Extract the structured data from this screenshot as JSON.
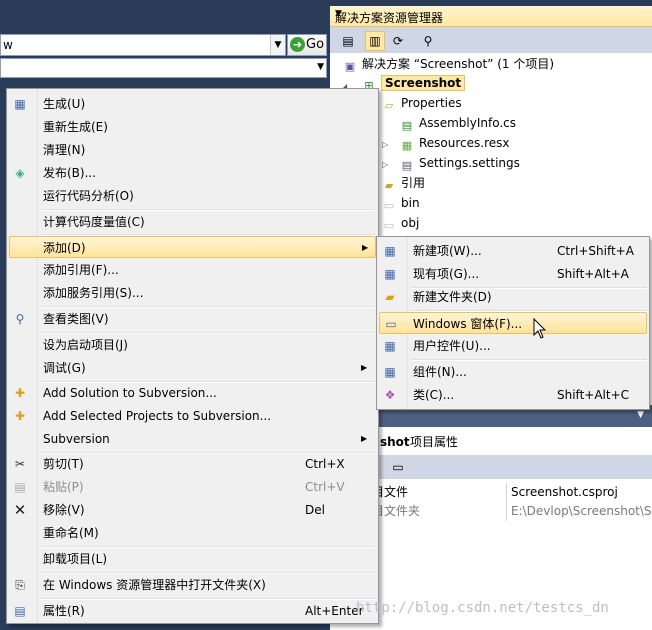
{
  "address_bar": {
    "combo_value": "w",
    "go_label": "Go"
  },
  "solution_explorer": {
    "title": "解决方案资源管理器",
    "solution_node": "解决方案 “Screenshot” (1 个项目)",
    "project_node": "Screenshot",
    "items": [
      {
        "label": "Properties",
        "icon": "folder-open-icon"
      },
      {
        "label": "AssemblyInfo.cs",
        "icon": "csharp-file-icon"
      },
      {
        "label": "Resources.resx",
        "icon": "resource-file-icon"
      },
      {
        "label": "Settings.settings",
        "icon": "settings-file-icon"
      },
      {
        "label": "引用",
        "icon": "references-folder-icon"
      },
      {
        "label": "bin",
        "icon": "folder-icon"
      },
      {
        "label": "obj",
        "icon": "folder-icon"
      }
    ]
  },
  "properties_panel": {
    "header_bold": "shot",
    "header_rest": "项目属性",
    "rows": [
      {
        "key": "目文件",
        "value": "Screenshot.csproj"
      },
      {
        "key": "目文件夹",
        "value": "E:\\Devlop\\Screenshot\\Scr"
      }
    ]
  },
  "context_menu": {
    "items": [
      {
        "label": "生成(U)",
        "icon": "build-icon"
      },
      {
        "label": "重新生成(E)"
      },
      {
        "label": "清理(N)"
      },
      {
        "label": "发布(B)...",
        "icon": "publish-icon"
      },
      {
        "label": "运行代码分析(O)"
      },
      {
        "label": "计算代码度量值(C)"
      },
      {
        "label": "添加(D)"
      },
      {
        "label": "添加引用(F)..."
      },
      {
        "label": "添加服务引用(S)..."
      },
      {
        "label": "查看类图(V)",
        "icon": "class-diagram-icon"
      },
      {
        "label": "设为启动项目(J)"
      },
      {
        "label": "调试(G)"
      },
      {
        "label": "Add Solution to Subversion...",
        "icon": "svn-add-icon"
      },
      {
        "label": "Add Selected Projects to Subversion...",
        "icon": "svn-add-selected-icon"
      },
      {
        "label": "Subversion"
      },
      {
        "label": "剪切(T)",
        "shortcut": "Ctrl+X",
        "icon": "cut-icon"
      },
      {
        "label": "粘贴(P)",
        "shortcut": "Ctrl+V",
        "icon": "paste-icon"
      },
      {
        "label": "移除(V)",
        "shortcut": "Del",
        "icon": "remove-icon"
      },
      {
        "label": "重命名(M)"
      },
      {
        "label": "卸载项目(L)"
      },
      {
        "label": "在 Windows 资源管理器中打开文件夹(X)",
        "icon": "open-folder-icon"
      },
      {
        "label": "属性(R)",
        "shortcut": "Alt+Enter",
        "icon": "properties-icon"
      }
    ]
  },
  "submenu": {
    "items": [
      {
        "label": "新建项(W)...",
        "shortcut": "Ctrl+Shift+A",
        "icon": "new-item-icon"
      },
      {
        "label": "现有项(G)...",
        "shortcut": "Shift+Alt+A",
        "icon": "existing-item-icon"
      },
      {
        "label": "新建文件夹(D)",
        "icon": "new-folder-icon"
      },
      {
        "label": "Windows 窗体(F)...",
        "icon": "windows-form-icon"
      },
      {
        "label": "用户控件(U)...",
        "icon": "user-control-icon"
      },
      {
        "label": "组件(N)...",
        "icon": "component-icon"
      },
      {
        "label": "类(C)...",
        "shortcut": "Shift+Alt+C",
        "icon": "class-icon"
      }
    ]
  },
  "watermark": "http://blog.csdn.net/testcs_dn",
  "colors": {
    "background": "#2b3c59",
    "highlight": "#ffe8a6",
    "menu": "#f0f0f0"
  }
}
